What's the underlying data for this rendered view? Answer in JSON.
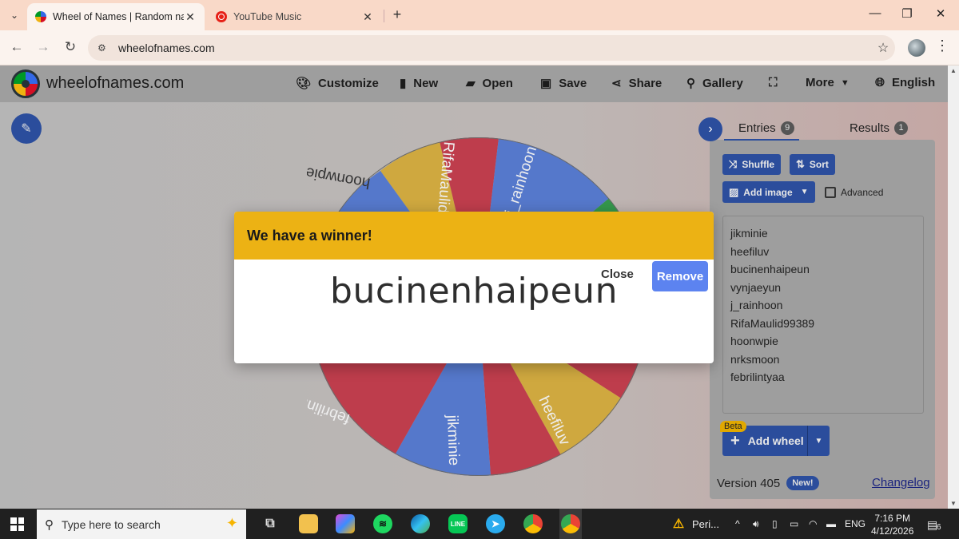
{
  "browser": {
    "tabs": [
      {
        "title": "Wheel of Names | Random nam",
        "active": true
      },
      {
        "title": "YouTube Music",
        "active": false
      }
    ],
    "url": "wheelofnames.com",
    "icons": {
      "menu": "chevron-down-icon",
      "back": "back-arrow-icon",
      "forward": "forward-arrow-icon",
      "reload": "reload-icon",
      "site_info": "tune-icon",
      "bookmark": "star-icon"
    }
  },
  "app": {
    "brand": "wheelofnames.com",
    "menu": [
      {
        "label": "Customize",
        "icon": "palette-icon"
      },
      {
        "label": "New",
        "icon": "file-icon"
      },
      {
        "label": "Open",
        "icon": "folder-icon"
      },
      {
        "label": "Save",
        "icon": "save-icon"
      },
      {
        "label": "Share",
        "icon": "share-icon"
      },
      {
        "label": "Gallery",
        "icon": "search-icon"
      },
      {
        "label": "",
        "icon": "fullscreen-icon"
      },
      {
        "label": "More",
        "icon": "chevron-down-icon"
      },
      {
        "label": "English",
        "icon": "globe-icon"
      }
    ]
  },
  "panel": {
    "tabs": [
      {
        "label": "Entries",
        "count": "9"
      },
      {
        "label": "Results",
        "count": "1"
      }
    ],
    "buttons": {
      "shuffle": "Shuffle",
      "sort": "Sort",
      "add_image": "Add image"
    },
    "advanced_label": "Advanced",
    "entries": [
      "jikminie",
      "heefiluv",
      "bucinenhaipeun",
      "vynjaeyun",
      "j_rainhoon",
      "RifaMaulid99389",
      "hoonwpie",
      "nrksmoon",
      "febrilintyaa"
    ],
    "beta_label": "Beta",
    "add_wheel": "Add wheel",
    "version": "Version 405",
    "new_badge": "New!",
    "changelog": "Changelog"
  },
  "wheel": {
    "visible_labels": [
      "RifaMaulid99389",
      "j_rainhoon",
      "hoonwpie",
      "febrilintyaa",
      "jikminie",
      "heefiluv"
    ],
    "colors": {
      "red": "#d50f25",
      "blue": "#3369e8",
      "yellow": "#eeb211",
      "green": "#009925"
    }
  },
  "dialog": {
    "heading": "We have a winner!",
    "winner": "bucinenhaipeun",
    "close": "Close",
    "remove": "Remove"
  },
  "taskbar": {
    "search_placeholder": "Type here to search",
    "notification_app": "Peri...",
    "language": "ENG",
    "time": "7:16 PM",
    "date": "4/12/2026",
    "notifications": "6"
  }
}
